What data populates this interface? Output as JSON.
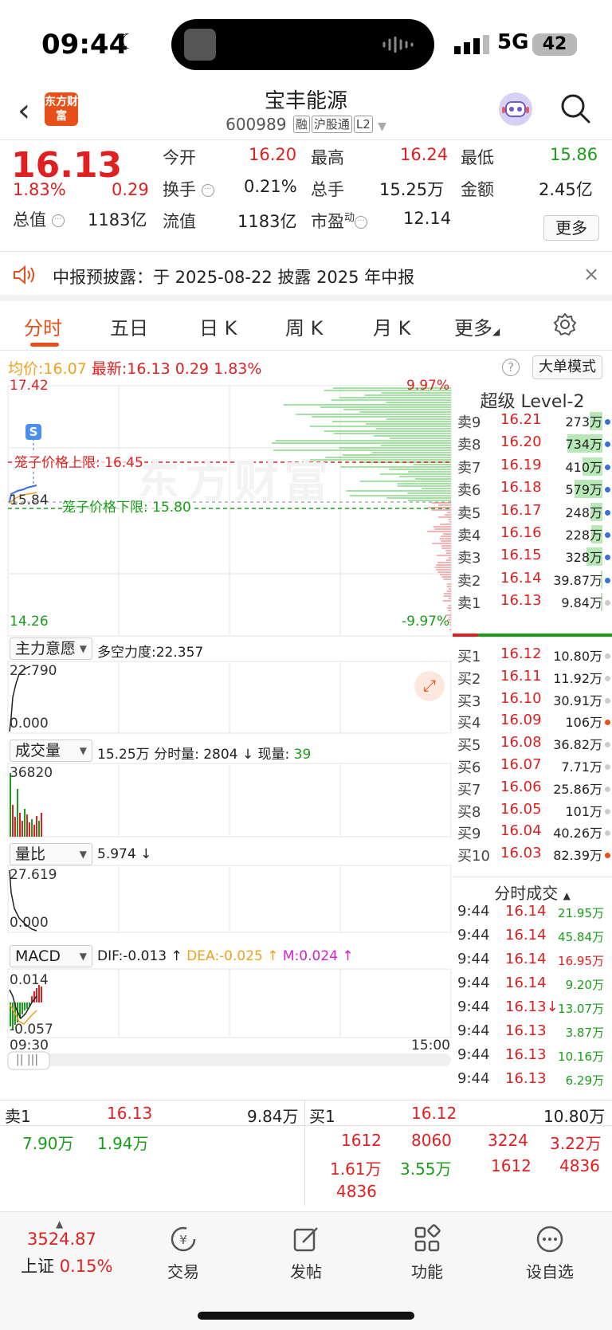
{
  "status": {
    "time": "09:44",
    "network": "5G",
    "battery": "42"
  },
  "header": {
    "title": "宝丰能源",
    "code": "600989",
    "tags": [
      "融",
      "沪股通",
      "L2"
    ],
    "logo": "东方财富"
  },
  "quote": {
    "price": "16.13",
    "change_pct": "1.83%",
    "change": "0.29",
    "open_label": "今开",
    "open": "16.20",
    "high_label": "最高",
    "high": "16.24",
    "low_label": "最低",
    "low": "15.86",
    "turnover_label": "换手",
    "turnover": "0.21%",
    "vol_label": "总手",
    "vol": "15.25万",
    "amount_label": "金额",
    "amount": "2.45亿",
    "mktcap_label": "总值",
    "mktcap": "1183亿",
    "float_label": "流值",
    "float": "1183亿",
    "pe_label": "市盈",
    "pe_sup": "动",
    "pe": "12.14",
    "more": "更多"
  },
  "notice": {
    "text": "中报预披露：于 2025-08-22 披露 2025 年中报",
    "close": "×"
  },
  "tabs": [
    "分时",
    "五日",
    "日 K",
    "周 K",
    "月 K",
    "更多"
  ],
  "avgline": {
    "avg_label": "均价:",
    "avg": "16.07",
    "last_label": "最新:",
    "last": "16.13",
    "chg": "0.29",
    "pct": "1.83%",
    "help": "?",
    "bigmode": "大单模式"
  },
  "chart": {
    "ymax": "17.42",
    "ymin": "14.26",
    "pct_max": "9.97%",
    "pct_min": "-9.97%",
    "cur_low": "15.84",
    "cage_upper": "笼子价格上限: 16.45",
    "cage_lower": "笼子价格下限: 15.80",
    "s_marker": "S",
    "watermark": "东方财富",
    "time_start": "09:30",
    "time_end": "15:00",
    "ind1": {
      "name": "主力意愿",
      "text": "多空力度:22.357",
      "max": "22.790",
      "min": "0.000"
    },
    "ind2": {
      "name": "成交量",
      "text_a": "15.25万 分时量: 2804 ↓ 现量: ",
      "text_b": "39",
      "max": "36820"
    },
    "ind3": {
      "name": "量比",
      "text": "5.974 ↓",
      "max": "27.619",
      "min": "0.000"
    },
    "ind4": {
      "name": "MACD",
      "dif": "DIF:-0.013 ↑",
      "dea": "DEA:-0.025 ↑",
      "m": "M:0.024 ↑",
      "max": "0.014",
      "min": "-0.057"
    }
  },
  "book": {
    "title": "超级 Level-2",
    "asks": [
      {
        "n": "卖9",
        "p": "16.21",
        "v": "273万",
        "bar": 0.37,
        "dot": "#3a6fd8"
      },
      {
        "n": "卖8",
        "p": "16.20",
        "v": "734万",
        "bar": 1.0,
        "dot": "#3a6fd8"
      },
      {
        "n": "卖7",
        "p": "16.19",
        "v": "410万",
        "bar": 0.56,
        "dot": "#3a6fd8"
      },
      {
        "n": "卖6",
        "p": "16.18",
        "v": "579万",
        "bar": 0.79,
        "dot": "#3a6fd8"
      },
      {
        "n": "卖5",
        "p": "16.17",
        "v": "248万",
        "bar": 0.34,
        "dot": "#3a6fd8"
      },
      {
        "n": "卖4",
        "p": "16.16",
        "v": "228万",
        "bar": 0.31,
        "dot": "#3a6fd8"
      },
      {
        "n": "卖3",
        "p": "16.15",
        "v": "328万",
        "bar": 0.45,
        "dot": "#3a6fd8"
      },
      {
        "n": "卖2",
        "p": "16.14",
        "v": "39.87万",
        "bar": 0.05,
        "dot": "#3a6fd8"
      },
      {
        "n": "卖1",
        "p": "16.13",
        "v": "9.84万",
        "bar": 0.01,
        "dot": "#cccccc"
      }
    ],
    "bids": [
      {
        "n": "买1",
        "p": "16.12",
        "v": "10.80万",
        "dot": "#cccccc"
      },
      {
        "n": "买2",
        "p": "16.11",
        "v": "11.92万",
        "dot": "#cccccc"
      },
      {
        "n": "买3",
        "p": "16.10",
        "v": "30.91万",
        "dot": "#cccccc"
      },
      {
        "n": "买4",
        "p": "16.09",
        "v": "106万",
        "dot": "#e8501a"
      },
      {
        "n": "买5",
        "p": "16.08",
        "v": "36.82万",
        "dot": "#cccccc"
      },
      {
        "n": "买6",
        "p": "16.07",
        "v": "7.71万",
        "dot": "#cccccc"
      },
      {
        "n": "买7",
        "p": "16.06",
        "v": "25.86万",
        "dot": "#cccccc"
      },
      {
        "n": "买8",
        "p": "16.05",
        "v": "101万",
        "dot": "#cccccc"
      },
      {
        "n": "买9",
        "p": "16.04",
        "v": "40.26万",
        "dot": "#cccccc"
      },
      {
        "n": "买10",
        "p": "16.03",
        "v": "82.39万",
        "dot": "#e8501a"
      }
    ]
  },
  "ticks": {
    "title": "分时成交",
    "rows": [
      {
        "t": "9:44",
        "p": "16.14",
        "v": "21.95万",
        "vc": "green"
      },
      {
        "t": "9:44",
        "p": "16.14",
        "v": "45.84万",
        "vc": "green"
      },
      {
        "t": "9:44",
        "p": "16.14",
        "v": "16.95万",
        "vc": "red"
      },
      {
        "t": "9:44",
        "p": "16.14",
        "v": "9.20万",
        "vc": "green"
      },
      {
        "t": "9:44",
        "p": "16.13↓",
        "v": "13.07万",
        "vc": "green"
      },
      {
        "t": "9:44",
        "p": "16.13",
        "v": "3.87万",
        "vc": "green"
      },
      {
        "t": "9:44",
        "p": "16.13",
        "v": "10.16万",
        "vc": "green"
      },
      {
        "t": "9:44",
        "p": "16.13",
        "v": "6.29万",
        "vc": "green"
      }
    ]
  },
  "bpanel": {
    "ask_label": "卖1",
    "ask_price": "16.13",
    "ask_vol": "9.84万",
    "bid_label": "买1",
    "bid_price": "16.12",
    "bid_vol": "10.80万",
    "ask_orders": [
      "7.90万",
      "1.94万"
    ],
    "bid_orders": [
      "1612",
      "8060",
      "3224",
      "3.22万",
      "1.61万",
      "3.55万",
      "1612",
      "4836",
      "4836"
    ]
  },
  "tabbar": {
    "index_value": "3524.87",
    "index_name": "上证",
    "index_pct": "0.15%",
    "items": [
      "交易",
      "发帖",
      "功能",
      "设自选"
    ]
  },
  "colors": {
    "up": "#e02020",
    "down": "#1a9e1a",
    "accent": "#e8501a"
  }
}
